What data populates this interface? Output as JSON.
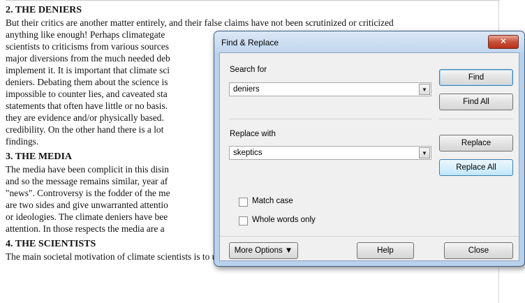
{
  "document": {
    "heading1": "2. THE DENIERS",
    "para1": [
      "But their critics are another matter entirely, and their false claims have not been scrutinized or criticized",
      "anything like enough! Perhaps climategate",
      "scientists to criticisms from various sources",
      "major diversions from the much needed deb",
      "implement it. It is important that climate sci",
      "deniers. Debating them about the science is",
      "impossible to counter lies, and caveated sta",
      "statements that often have little or no basis.",
      "they are evidence and/or physically based.",
      "credibility. On the other hand there is a lot",
      "findings."
    ],
    "heading2": "3. THE MEDIA",
    "para2": [
      "The media have been complicit in this disin",
      "and so the message remains similar, year af",
      "\"news\". Controversy is the fodder of the me",
      "are two sides and give unwarranted attentio",
      "or ideologies. The climate deniers have bee",
      "attention. In those respects the media are a"
    ],
    "heading3": "4. THE SCIENTISTS",
    "para3": "The main societal motivation of climate scientists is to understand the dynamics of the climate system"
  },
  "dialog": {
    "title": "Find & Replace",
    "close_label": "✕",
    "search_label": "Search for",
    "search_value": "deniers",
    "replace_label": "Replace with",
    "replace_value": "skeptics",
    "find_button": "Find",
    "find_all_button": "Find All",
    "replace_button": "Replace",
    "replace_all_button": "Replace All",
    "match_case_label": "Match case",
    "whole_words_label": "Whole words only",
    "more_options_button": "More Options ▼",
    "help_button": "Help",
    "close_button": "Close"
  }
}
